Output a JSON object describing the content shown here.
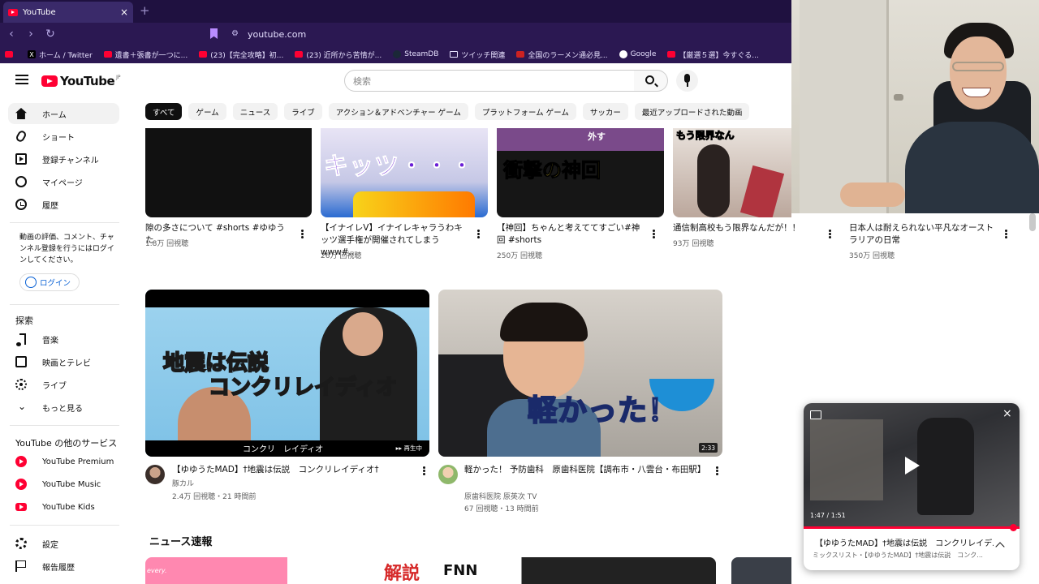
{
  "browser": {
    "tab_title": "YouTube",
    "tab_close": "×",
    "new_tab": "+",
    "back": "‹",
    "forward": "›",
    "reload": "↻",
    "url": "youtube.com",
    "bookmarks": [
      {
        "label": "",
        "icon": "youtube-icon"
      },
      {
        "label": "ホーム / Twitter",
        "icon": "x-icon"
      },
      {
        "label": "遺書＋張書が一つに...",
        "icon": "page-icon"
      },
      {
        "label": "(23)【完全攻略】初...",
        "icon": "youtube-icon"
      },
      {
        "label": "(23) 近所から苦情が...",
        "icon": "youtube-icon"
      },
      {
        "label": "SteamDB",
        "icon": "steam-icon"
      },
      {
        "label": "ツイッチ関連",
        "icon": "folder-icon"
      },
      {
        "label": "全国のラーメン通必見...",
        "icon": "ramen-icon"
      },
      {
        "label": "Google",
        "icon": "google-icon"
      },
      {
        "label": "【厳選５選】今すぐる...",
        "icon": "youtube-icon"
      }
    ]
  },
  "masthead": {
    "logo": "YouTube",
    "region": "JP",
    "search_placeholder": "検索"
  },
  "chips": [
    "すべて",
    "ゲーム",
    "ニュース",
    "ライブ",
    "アクション＆アドベンチャー ゲーム",
    "プラットフォーム ゲーム",
    "サッカー",
    "最近アップロードされた動画"
  ],
  "sidebar": {
    "main": [
      {
        "label": "ホーム",
        "icon": "home-icon",
        "active": true
      },
      {
        "label": "ショート",
        "icon": "shorts-icon"
      },
      {
        "label": "登録チャンネル",
        "icon": "subscriptions-icon"
      },
      {
        "label": "マイページ",
        "icon": "you-icon"
      },
      {
        "label": "履歴",
        "icon": "history-icon"
      }
    ],
    "signin_text": "動画の評価、コメント、チャンネル登録を行うにはログインしてください。",
    "signin_button": "ログイン",
    "explore_heading": "探索",
    "explore": [
      {
        "label": "音楽",
        "icon": "music-icon"
      },
      {
        "label": "映画とテレビ",
        "icon": "movie-icon"
      },
      {
        "label": "ライブ",
        "icon": "live-icon"
      },
      {
        "label": "もっと見る",
        "icon": "chevron-down-icon"
      }
    ],
    "more_heading": "YouTube の他のサービス",
    "more": [
      {
        "label": "YouTube Premium"
      },
      {
        "label": "YouTube Music"
      },
      {
        "label": "YouTube Kids"
      }
    ],
    "footer": [
      {
        "label": "設定",
        "icon": "gear-icon"
      },
      {
        "label": "報告履歴",
        "icon": "flag-icon"
      }
    ]
  },
  "shorts_row": [
    {
      "title": "隙の多さについて  #shorts #ゆゆうた",
      "views": "1.8万 回視聴"
    },
    {
      "title": "【イナイレV】イナイレキャラうわキッツ選手権が開催されてしまうwww#...",
      "views": "26万 回視聴",
      "thumb_text": "キッツ・・・"
    },
    {
      "title": "【神回】ちゃんと考えててすごい#神回 #shorts",
      "views": "250万 回視聴",
      "thumb_text": "衝撃の神回",
      "thumb_top": "外す"
    },
    {
      "title": "通信制高校もう限界なんだが！！",
      "views": "93万 回視聴",
      "thumb_text": "もう限界なん"
    },
    {
      "title": "日本人は耐えられない平凡なオーストラリアの日常",
      "views": "350万 回視聴"
    }
  ],
  "videos": [
    {
      "title": "【ゆゆうたMAD】†地震は伝説　コンクリレイディオ†",
      "channel": "豚カル",
      "meta": "2.4万 回視聴・21 時間前",
      "thumb_line1": "地震は伝説",
      "thumb_line2": "コンクリレイディオ",
      "thumb_sub": "コンクリ　レイディオ",
      "badge": "▸▸ 再生中"
    },
    {
      "title": "軽かった！ 予防歯科　原歯科医院【調布市・八雲台・布田駅】",
      "channel": "原歯科医院 原英次 TV",
      "meta": "67 回視聴・13 時間前",
      "thumb_text": "軽かった！",
      "badge": "2:33"
    }
  ],
  "news_section": {
    "title": "ニュース速報",
    "items": [
      {
        "tag": "every.",
        "thumb_text": "解説"
      },
      {
        "thumb_text": "FNN"
      },
      {
        "thumb_text": ""
      }
    ]
  },
  "miniplayer": {
    "time": "1:47 / 1:51",
    "progress": 0.964,
    "title": "【ゆゆうたMAD】†地震は伝説　コンクリレイデ...",
    "subtitle": "ミックスリスト・【ゆゆうたMAD】†地震は伝説　コンク...",
    "close": "×"
  }
}
